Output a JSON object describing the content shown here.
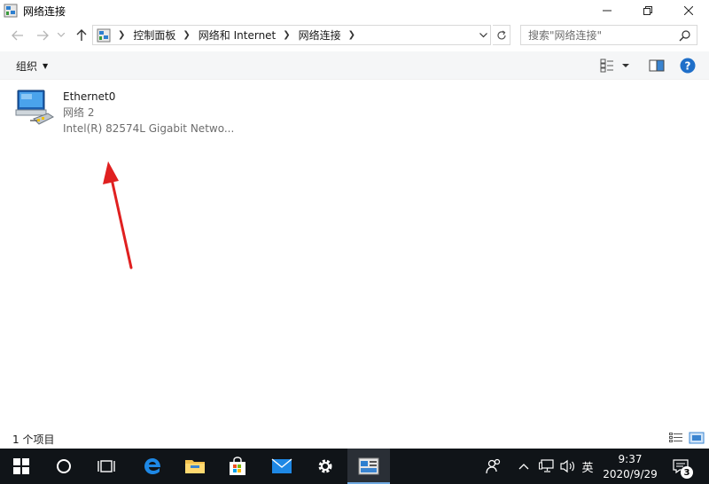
{
  "window": {
    "title": "网络连接",
    "minimize_icon": "minimize-icon",
    "maximize_icon": "restore-icon",
    "close_icon": "close-icon"
  },
  "address_bar": {
    "breadcrumbs": [
      "控制面板",
      "网络和 Internet",
      "网络连接"
    ],
    "search_placeholder": "搜索\"网络连接\""
  },
  "command_bar": {
    "organize_label": "组织"
  },
  "items": [
    {
      "name": "Ethernet0",
      "network": "网络 2",
      "device": "Intel(R) 82574L Gigabit Netwo..."
    }
  ],
  "status_bar": {
    "item_count": "1 个项目"
  },
  "taskbar": {
    "ime": "英",
    "time": "9:37",
    "date": "2020/9/29",
    "notification_count": "3"
  },
  "colors": {
    "accent_blue": "#0078d7",
    "taskbar_bg": "#101418",
    "annotation_arrow": "#e02020"
  }
}
